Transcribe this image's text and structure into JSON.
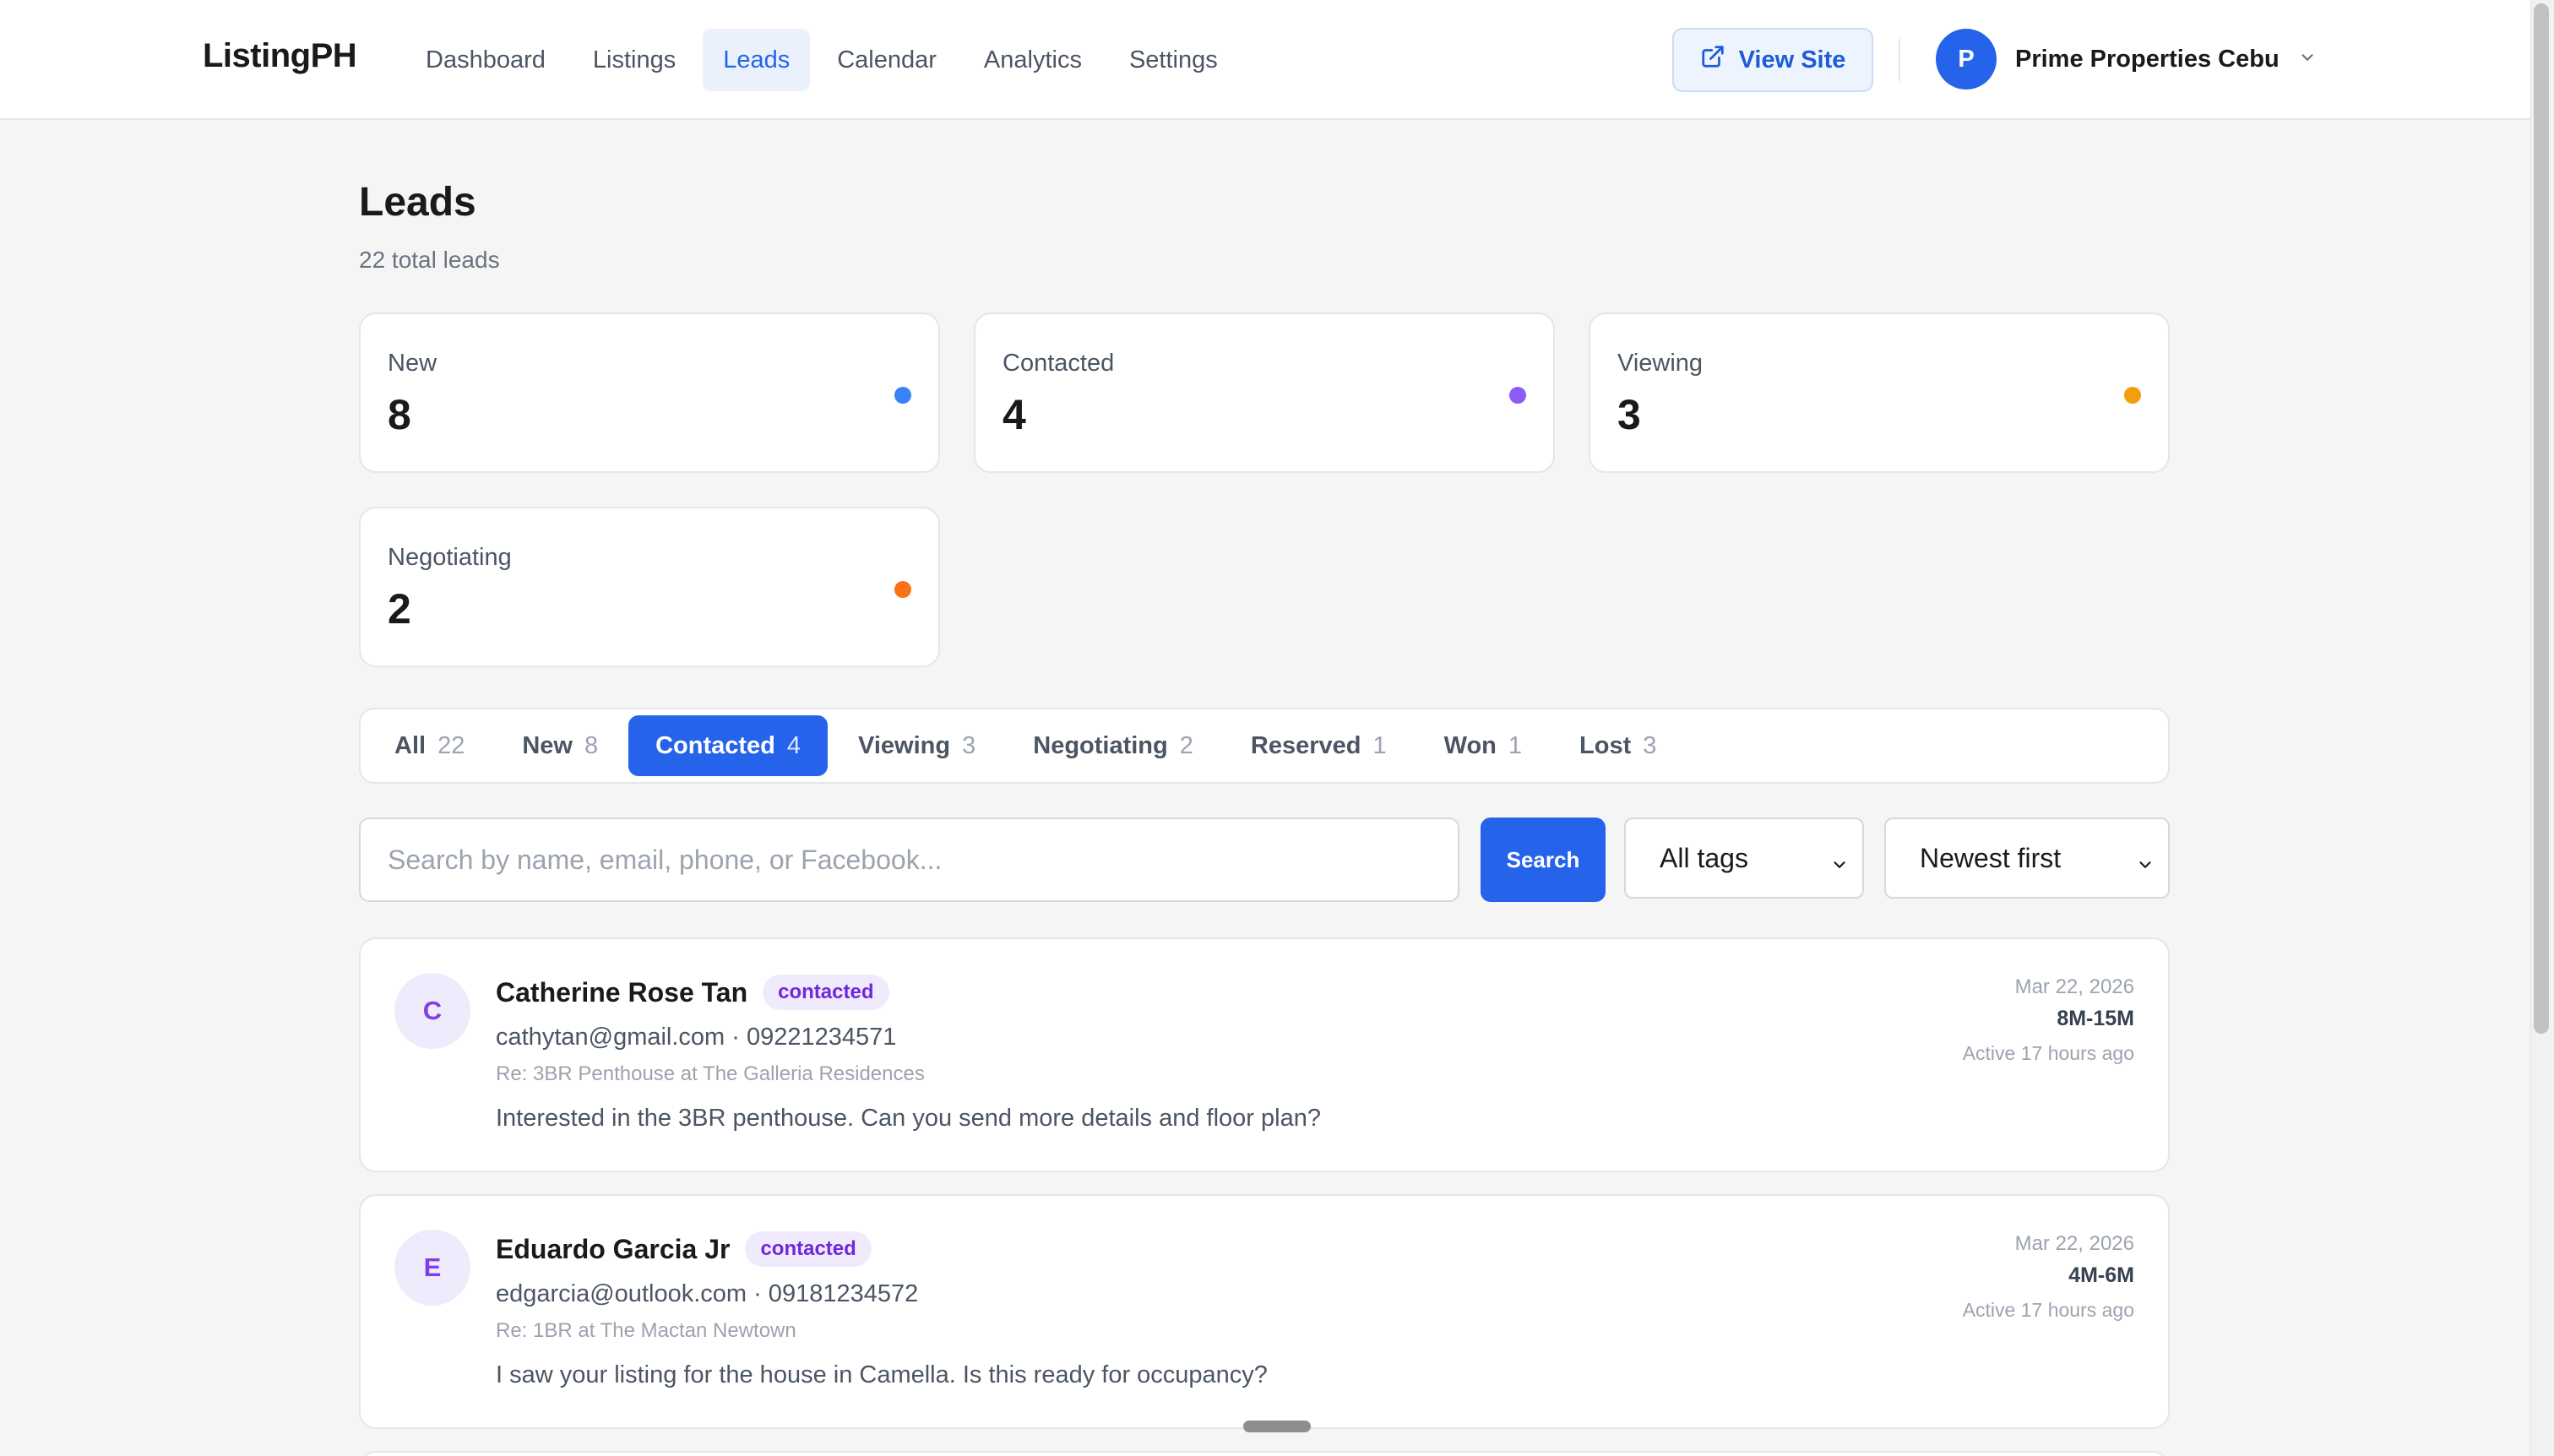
{
  "app": {
    "brand": "ListingPH"
  },
  "nav": {
    "items": [
      {
        "label": "Dashboard",
        "active": false
      },
      {
        "label": "Listings",
        "active": false
      },
      {
        "label": "Leads",
        "active": true
      },
      {
        "label": "Calendar",
        "active": false
      },
      {
        "label": "Analytics",
        "active": false
      },
      {
        "label": "Settings",
        "active": false
      }
    ],
    "view_site": "View Site",
    "account": {
      "initial": "P",
      "name": "Prime Properties Cebu"
    }
  },
  "page": {
    "title": "Leads",
    "subtitle": "22 total leads"
  },
  "stats": [
    {
      "label": "New",
      "value": "8",
      "color": "#3b82f6"
    },
    {
      "label": "Contacted",
      "value": "4",
      "color": "#8b5cf6"
    },
    {
      "label": "Viewing",
      "value": "3",
      "color": "#f59e0b"
    },
    {
      "label": "Negotiating",
      "value": "2",
      "color": "#f97316"
    }
  ],
  "tabs": [
    {
      "label": "All",
      "count": "22",
      "active": false
    },
    {
      "label": "New",
      "count": "8",
      "active": false
    },
    {
      "label": "Contacted",
      "count": "4",
      "active": true
    },
    {
      "label": "Viewing",
      "count": "3",
      "active": false
    },
    {
      "label": "Negotiating",
      "count": "2",
      "active": false
    },
    {
      "label": "Reserved",
      "count": "1",
      "active": false
    },
    {
      "label": "Won",
      "count": "1",
      "active": false
    },
    {
      "label": "Lost",
      "count": "3",
      "active": false
    }
  ],
  "search": {
    "placeholder": "Search by name, email, phone, or Facebook...",
    "value": "",
    "button": "Search"
  },
  "filters": {
    "tags": "All tags",
    "sort": "Newest first"
  },
  "leads": [
    {
      "initial": "C",
      "name": "Catherine Rose Tan",
      "status": "contacted",
      "contact": "cathytan@gmail.com · 09221234571",
      "regarding": "Re: 3BR Penthouse at The Galleria Residences",
      "message": "Interested in the 3BR penthouse. Can you send more details and floor plan?",
      "date": "Mar 22, 2026",
      "budget": "8M-15M",
      "activity": "Active 17 hours ago"
    },
    {
      "initial": "E",
      "name": "Eduardo Garcia Jr",
      "status": "contacted",
      "contact": "edgarcia@outlook.com · 09181234572",
      "regarding": "Re: 1BR at The Mactan Newtown",
      "message": "I saw your listing for the house in Camella. Is this ready for occupancy?",
      "date": "Mar 22, 2026",
      "budget": "4M-6M",
      "activity": "Active 17 hours ago"
    }
  ]
}
